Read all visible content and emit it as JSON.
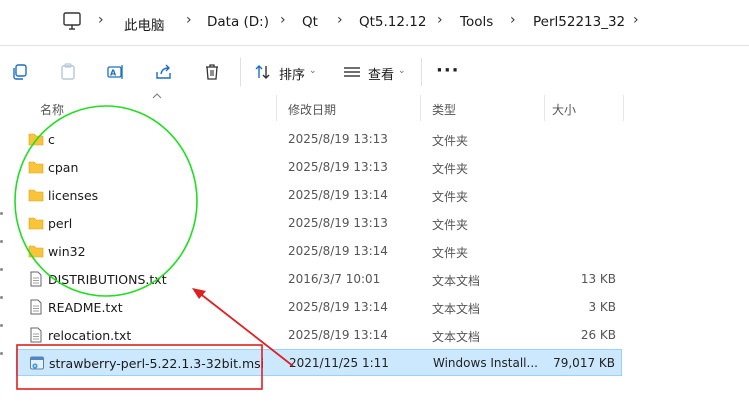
{
  "breadcrumb": {
    "items": [
      "此电脑",
      "Data (D:)",
      "Qt",
      "Qt5.12.12",
      "Tools",
      "Perl52213_32"
    ]
  },
  "toolbar": {
    "sort_label": "排序",
    "view_label": "查看",
    "more_label": "···"
  },
  "columns": {
    "name": "名称",
    "modified": "修改日期",
    "type": "类型",
    "size": "大小"
  },
  "files": [
    {
      "name": "c",
      "modified": "2025/8/19 13:13",
      "type": "文件夹",
      "size": "",
      "icon": "folder-icon"
    },
    {
      "name": "cpan",
      "modified": "2025/8/19 13:13",
      "type": "文件夹",
      "size": "",
      "icon": "folder-icon"
    },
    {
      "name": "licenses",
      "modified": "2025/8/19 13:14",
      "type": "文件夹",
      "size": "",
      "icon": "folder-icon"
    },
    {
      "name": "perl",
      "modified": "2025/8/19 13:13",
      "type": "文件夹",
      "size": "",
      "icon": "folder-icon"
    },
    {
      "name": "win32",
      "modified": "2025/8/19 13:14",
      "type": "文件夹",
      "size": "",
      "icon": "folder-icon"
    },
    {
      "name": "DISTRIBUTIONS.txt",
      "modified": "2016/3/7 10:01",
      "type": "文本文档",
      "size": "13 KB",
      "icon": "text-file-icon"
    },
    {
      "name": "README.txt",
      "modified": "2025/8/19 13:14",
      "type": "文本文档",
      "size": "3 KB",
      "icon": "text-file-icon"
    },
    {
      "name": "relocation.txt",
      "modified": "2025/8/19 13:14",
      "type": "文本文档",
      "size": "26 KB",
      "icon": "text-file-icon"
    },
    {
      "name": "strawberry-perl-5.22.1.3-32bit.msi",
      "modified": "2021/11/25 1:11",
      "type": "Windows Install...",
      "size": "79,017 KB",
      "icon": "msi-installer-icon",
      "selected": true
    }
  ],
  "colors": {
    "folder": "#f8c53a",
    "selection": "#cce8ff",
    "annotation_green": "#22dd22",
    "annotation_red": "#e02020"
  }
}
